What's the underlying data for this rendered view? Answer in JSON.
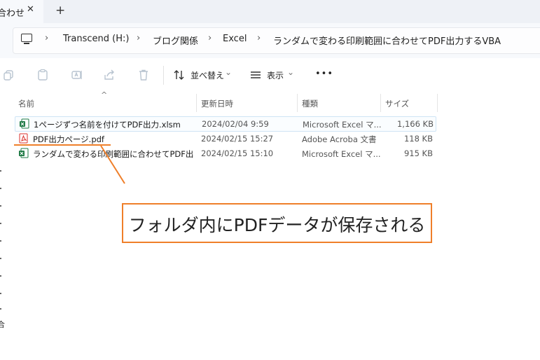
{
  "tab": {
    "title": "合わせ",
    "close": "✕",
    "new_tab": "+"
  },
  "address": {
    "crumbs": [
      "Transcend (H:)",
      "ブログ関係",
      "Excel",
      "ランダムで変わる印刷範囲に合わせてPDF出力するVBA"
    ],
    "separator": "›"
  },
  "toolbar": {
    "sort_label": "並べ替え",
    "view_label": "表示",
    "more": "•••",
    "chevron": "⌄"
  },
  "columns": {
    "name": "名前",
    "modified": "更新日時",
    "type": "種類",
    "size": "サイズ",
    "sort_caret": "^"
  },
  "files": [
    {
      "name": "1ページずつ名前を付けてPDF出力.xlsm",
      "modified": "2024/02/04 9:59",
      "type": "Microsoft Excel マ...",
      "size": "1,166 KB",
      "icon": "excel-icon"
    },
    {
      "name": "PDF出力ページ.pdf",
      "modified": "2024/02/15 15:27",
      "type": "Adobe Acroba 文書",
      "size": "118 KB",
      "icon": "pdf-icon"
    },
    {
      "name": "ランダムで変わる印刷範囲に合わせてPDF出力...",
      "modified": "2024/02/15 15:10",
      "type": "Microsoft Excel マ...",
      "size": "915 KB",
      "icon": "excel-icon"
    }
  ],
  "annotation": {
    "text": "フォルダ内にPDFデータが保存される"
  },
  "left_rail": {
    "text": "合"
  },
  "colors": {
    "accent": "#ef7f2a",
    "excel": "#1f7a45",
    "pdf": "#d9302c"
  }
}
